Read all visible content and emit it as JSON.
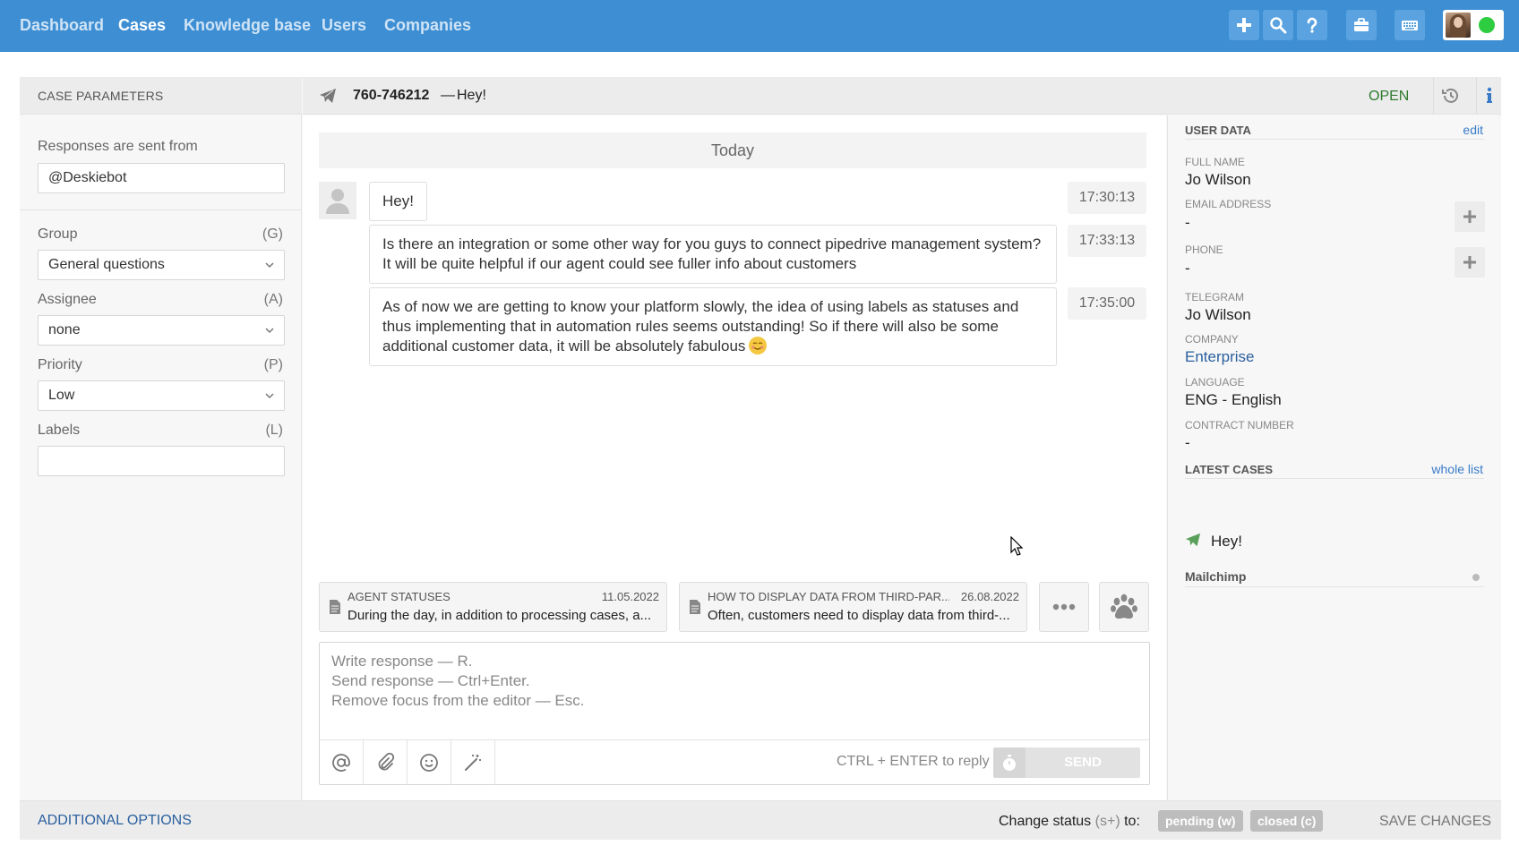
{
  "nav": {
    "links": [
      "Dashboard",
      "Cases",
      "Knowledge base",
      "Users",
      "Companies"
    ],
    "active": "Cases",
    "icons": [
      "plus-icon",
      "search-icon",
      "help-icon",
      "briefcase-icon",
      "keyboard-icon"
    ],
    "status_color": "#2ecc40"
  },
  "left": {
    "title": "CASE PARAMETERS",
    "sent_from_label": "Responses are sent from",
    "sent_from_value": "@Deskiebot",
    "group_label": "Group",
    "group_hint": "(G)",
    "group_value": "General questions",
    "assignee_label": "Assignee",
    "assignee_hint": "(A)",
    "assignee_value": "none",
    "priority_label": "Priority",
    "priority_hint": "(P)",
    "priority_value": "Low",
    "labels_label": "Labels",
    "labels_hint": "(L)",
    "labels_value": ""
  },
  "case": {
    "id": "760-746212",
    "dash": "—",
    "subject": "Hey!",
    "status": "OPEN"
  },
  "chat": {
    "day": "Today",
    "messages": [
      {
        "text": "Hey!",
        "time": "17:30:13"
      },
      {
        "text": "Is there an integration or some other way for you guys to connect pipedrive management system? It will be quite helpful if our agent could see fuller info about customers",
        "time": "17:33:13"
      },
      {
        "text": "As of now we are getting to know your platform slowly, the idea of using labels as statuses and thus implementing that in automation rules seems outstanding! So if there will also be some additional customer data, it will be absolutely fabulous",
        "time": "17:35:00"
      }
    ]
  },
  "kb": [
    {
      "title": "AGENT STATUSES",
      "date": "11.05.2022",
      "body": "During the day, in addition to processing cases, a..."
    },
    {
      "title": "HOW TO DISPLAY DATA FROM THIRD-PAR...",
      "date": "26.08.2022",
      "body": "Often, customers need to display data from third-..."
    }
  ],
  "editor": {
    "placeholder_lines": [
      "Write response — R.",
      "Send response — Ctrl+Enter.",
      "Remove focus from the editor — Esc."
    ],
    "reply_hint": "CTRL + ENTER to reply",
    "send_label": "SEND"
  },
  "user_data": {
    "title": "USER DATA",
    "edit": "edit",
    "full_name_label": "FULL NAME",
    "full_name": "Jo Wilson",
    "email_label": "EMAIL ADDRESS",
    "email": "-",
    "phone_label": "PHONE",
    "phone": "-",
    "telegram_label": "TELEGRAM",
    "telegram": "Jo Wilson",
    "company_label": "COMPANY",
    "company": "Enterprise",
    "language_label": "LANGUAGE",
    "language": "ENG - English",
    "contract_label": "CONTRACT NUMBER",
    "contract": "-"
  },
  "latest_cases": {
    "title": "LATEST CASES",
    "link": "whole list",
    "item": "Hey!",
    "group": "Mailchimp"
  },
  "bottom": {
    "additional": "ADDITIONAL OPTIONS",
    "change_status_prefix": "Change status",
    "change_status_key": "(s+)",
    "change_status_suffix": "to:",
    "pending": "pending (w)",
    "closed": "closed (c)",
    "save": "SAVE CHANGES"
  }
}
